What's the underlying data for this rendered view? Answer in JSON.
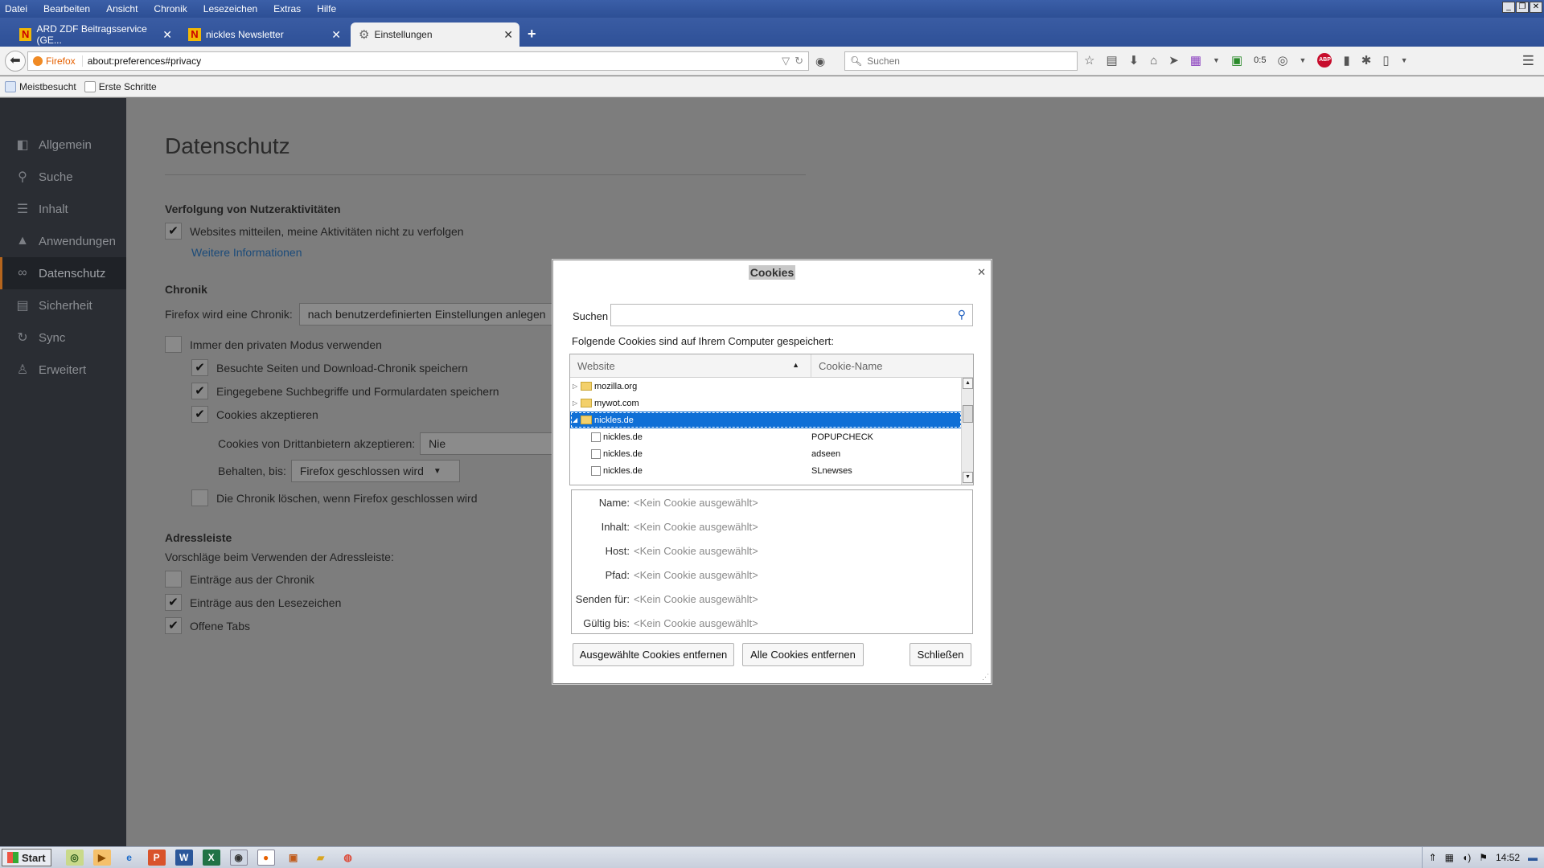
{
  "menubar": {
    "items": [
      "Datei",
      "Bearbeiten",
      "Ansicht",
      "Chronik",
      "Lesezeichen",
      "Extras",
      "Hilfe"
    ]
  },
  "tabs": [
    {
      "label": "ARD ZDF Beitragsservice (GE...",
      "favicon": "N"
    },
    {
      "label": "nickles Newsletter",
      "favicon": "N"
    },
    {
      "label": "Einstellungen",
      "favicon": "gear-icon"
    }
  ],
  "navbar": {
    "identity": "Firefox",
    "url": "about:preferences#privacy",
    "search_placeholder": "Suchen",
    "counter": "0:5",
    "abp": "ABP"
  },
  "bookmarks": [
    "Meistbesucht",
    "Erste Schritte"
  ],
  "sidebar": {
    "items": [
      {
        "label": "Allgemein",
        "icon": "switch-icon"
      },
      {
        "label": "Suche",
        "icon": "search-icon"
      },
      {
        "label": "Inhalt",
        "icon": "document-icon"
      },
      {
        "label": "Anwendungen",
        "icon": "rocket-icon"
      },
      {
        "label": "Datenschutz",
        "icon": "mask-icon"
      },
      {
        "label": "Sicherheit",
        "icon": "lock-icon"
      },
      {
        "label": "Sync",
        "icon": "sync-icon"
      },
      {
        "label": "Erweitert",
        "icon": "wizard-icon"
      }
    ],
    "selected": "Datenschutz"
  },
  "main": {
    "title": "Datenschutz",
    "tracking": {
      "heading": "Verfolgung von Nutzeraktivitäten",
      "dnt_label": "Websites mitteilen, meine Aktivitäten nicht zu verfolgen",
      "dnt_checked": true,
      "more_info": "Weitere Informationen"
    },
    "history": {
      "heading": "Chronik",
      "mode_label": "Firefox wird eine Chronik:",
      "mode_value": "nach benutzerdefinierten Einstellungen anlegen",
      "private_label": "Immer den privaten Modus verwenden",
      "visited_label": "Besuchte Seiten und Download-Chronik speichern",
      "search_label": "Eingegebene Suchbegriffe und Formulardaten speichern",
      "cookies_label": "Cookies akzeptieren",
      "third_party_label": "Cookies von Drittanbietern akzeptieren:",
      "third_party_value": "Nie",
      "keep_label": "Behalten, bis:",
      "keep_value": "Firefox geschlossen wird",
      "clear_label": "Die Chronik löschen, wenn Firefox geschlossen wird"
    },
    "addressbar": {
      "heading": "Adressleiste",
      "desc": "Vorschläge beim Verwenden der Adressleiste:",
      "history_label": "Einträge aus der Chronik",
      "bookmarks_label": "Einträge aus den Lesezeichen",
      "tabs_label": "Offene Tabs"
    }
  },
  "dialog": {
    "title": "Cookies",
    "search_label": "Suchen",
    "stored_label": "Folgende Cookies sind auf Ihrem Computer gespeichert:",
    "col_website": "Website",
    "col_cookie": "Cookie-Name",
    "rows": [
      {
        "site": "mozilla.org",
        "cookie": "",
        "type": "folder",
        "state": "collapsed"
      },
      {
        "site": "mywot.com",
        "cookie": "",
        "type": "folder",
        "state": "collapsed"
      },
      {
        "site": "nickles.de",
        "cookie": "",
        "type": "folder",
        "state": "expanded",
        "selected": true
      },
      {
        "site": "nickles.de",
        "cookie": "POPUPCHECK",
        "type": "cookie"
      },
      {
        "site": "nickles.de",
        "cookie": "adseen",
        "type": "cookie"
      },
      {
        "site": "nickles.de",
        "cookie": "SLnewses",
        "type": "cookie"
      }
    ],
    "details": [
      {
        "label": "Name:",
        "value": "<Kein Cookie ausgewählt>"
      },
      {
        "label": "Inhalt:",
        "value": "<Kein Cookie ausgewählt>"
      },
      {
        "label": "Host:",
        "value": "<Kein Cookie ausgewählt>"
      },
      {
        "label": "Pfad:",
        "value": "<Kein Cookie ausgewählt>"
      },
      {
        "label": "Senden für:",
        "value": "<Kein Cookie ausgewählt>"
      },
      {
        "label": "Gültig bis:",
        "value": "<Kein Cookie ausgewählt>"
      }
    ],
    "btn_remove_selected": "Ausgewählte Cookies entfernen",
    "btn_remove_all": "Alle Cookies entfernen",
    "btn_close": "Schließen"
  },
  "taskbar": {
    "start": "Start",
    "clock": "14:52"
  }
}
